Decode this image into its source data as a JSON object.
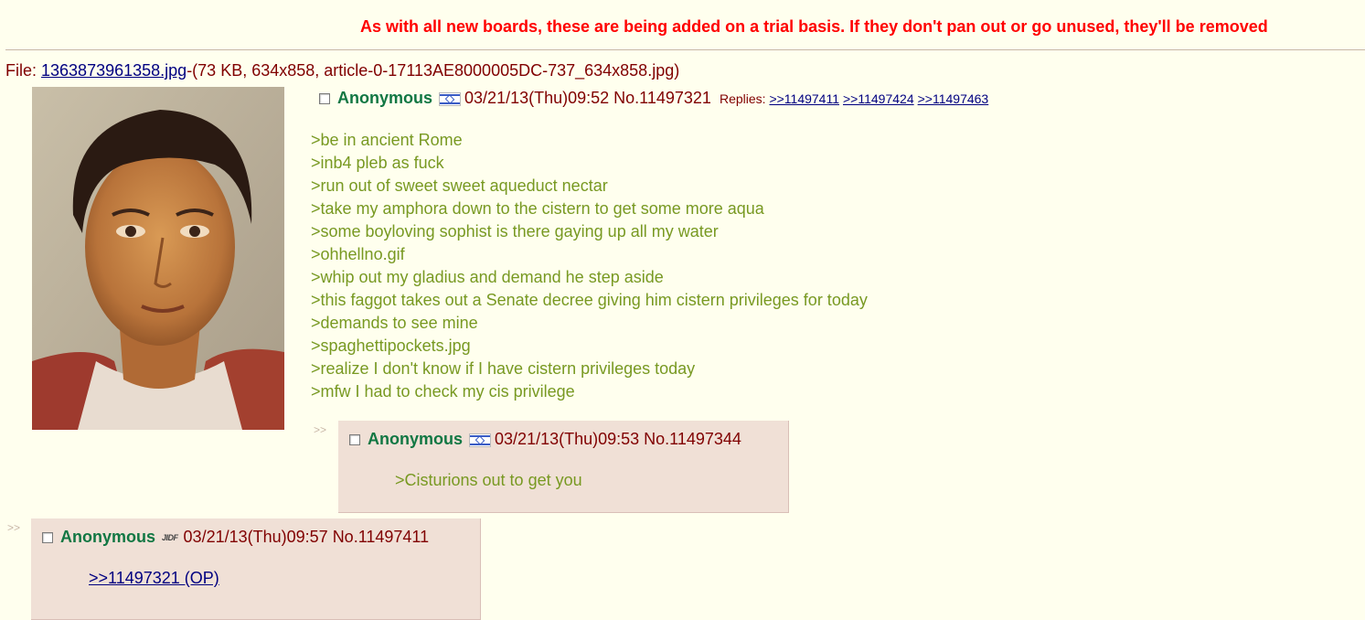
{
  "announcement": "As with all new boards, these are being added on a trial basis. If they don't pan out or go unused, they'll be removed",
  "op": {
    "file_prefix": "File: ",
    "file_name": "1363873961358.jpg",
    "file_details": "-(73 KB, 634x858, article-0-17113AE8000005DC-737_634x858.jpg)",
    "name": "Anonymous",
    "flag_icon": "israel-flag-icon",
    "datetime": "03/21/13(Thu)09:52",
    "post_no": "No.11497321",
    "replies_label": "Replies:",
    "replies": [
      ">>11497411",
      ">>11497424",
      ">>11497463"
    ],
    "lines": [
      ">be in ancient Rome",
      ">inb4 pleb as fuck",
      ">run out of sweet sweet aqueduct nectar",
      ">take my amphora down to the cistern to get some more aqua",
      ">some boyloving sophist is there gaying up all my water",
      ">ohhellno.gif",
      ">whip out my gladius and demand he step aside",
      ">this faggot takes out a Senate decree giving him cistern privileges for today",
      ">demands to see mine",
      ">spaghettipockets.jpg",
      ">realize I don't know if I have cistern privileges today",
      ">mfw I had to check my cis privilege"
    ]
  },
  "replies": [
    {
      "arrows": ">>",
      "name": "Anonymous",
      "flag_icon": "israel-flag-icon",
      "datetime": "03/21/13(Thu)09:53",
      "post_no": "No.11497344",
      "text": ">Cisturions out to get you"
    },
    {
      "arrows": ">>",
      "name": "Anonymous",
      "flag_label": "JIDF",
      "datetime": "03/21/13(Thu)09:57",
      "post_no": "No.11497411",
      "link": ">>11497321 (OP)"
    }
  ],
  "colors": {
    "background": "#FFFFEE",
    "reply_bg": "#F0E0D6",
    "name": "#117743",
    "greentext": "#789922",
    "announcement": "#FF0000",
    "link": "#000080"
  }
}
